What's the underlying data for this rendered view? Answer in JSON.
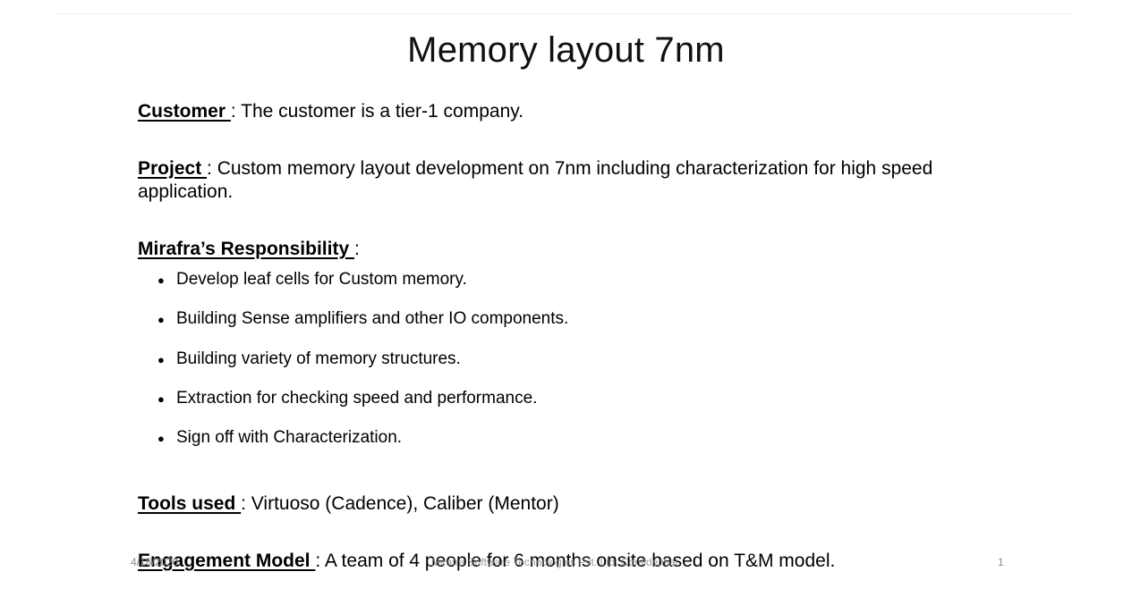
{
  "slide": {
    "title": "Memory layout 7nm",
    "customer": {
      "label": "Customer ",
      "text": ": The customer is a tier-1 company."
    },
    "project": {
      "label": "Project ",
      "text": ": Custom memory layout development on 7nm including characterization for high speed application."
    },
    "responsibility": {
      "label": "Mirafra’s Responsibility ",
      "text": ":",
      "items": [
        "Develop leaf cells for Custom memory.",
        "Building Sense amplifiers and other IO components.",
        "Building variety of memory structures.",
        "Extraction for checking speed and performance.",
        "Sign off with Characterization."
      ]
    },
    "tools": {
      "label": "Tools used ",
      "text": ": Virtuoso (Cadence), Caliber (Mentor)"
    },
    "engagement": {
      "label": "Engagement Model ",
      "text": ": A team of 4 people for 6 months onsite based on T&M model."
    }
  },
  "footer": {
    "date": "4/18/2020",
    "center": "Mirafra Software Technologies Pvt. Ltd. Confidential",
    "page_number": "1"
  }
}
